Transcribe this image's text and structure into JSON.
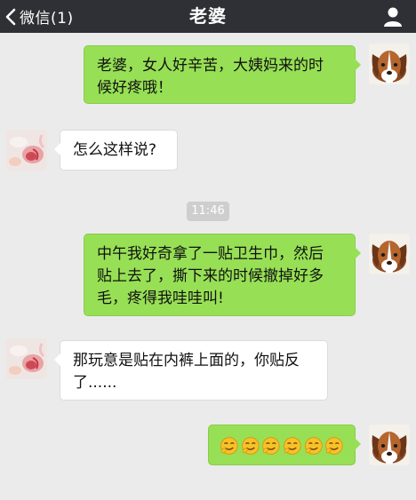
{
  "header": {
    "back_label": "微信(1)",
    "title": "老婆"
  },
  "messages": [
    {
      "id": "m1",
      "sender": "me",
      "lines": [
        "老婆，女人好辛苦，大姨妈来的时",
        "候好疼哦！"
      ]
    },
    {
      "id": "m2",
      "sender": "wife",
      "lines": [
        "怎么这样说?"
      ]
    },
    {
      "id": "m3",
      "sender": "me",
      "lines": [
        "中午我好奇拿了一贴卫生巾，然后",
        "贴上去了，撕下来的时候撤掉好多",
        "毛，疼得我哇哇叫!"
      ]
    },
    {
      "id": "m4",
      "sender": "wife",
      "lines": [
        "那玩意是贴在内裤上面的，你贴反",
        "了......"
      ]
    },
    {
      "id": "m5",
      "sender": "me",
      "emoji": "smirk-face-icon",
      "emoji_count": 6
    }
  ],
  "timestamp": "11:46",
  "colors": {
    "topbar": "#2f3035",
    "background": "#ebebeb",
    "outgoing_bubble": "#97e055",
    "incoming_bubble": "#ffffff"
  },
  "icons": {
    "back": "chevron-left-icon",
    "profile": "person-icon",
    "my_avatar": "puppy-avatar",
    "wife_avatar": "flower-avatar"
  }
}
